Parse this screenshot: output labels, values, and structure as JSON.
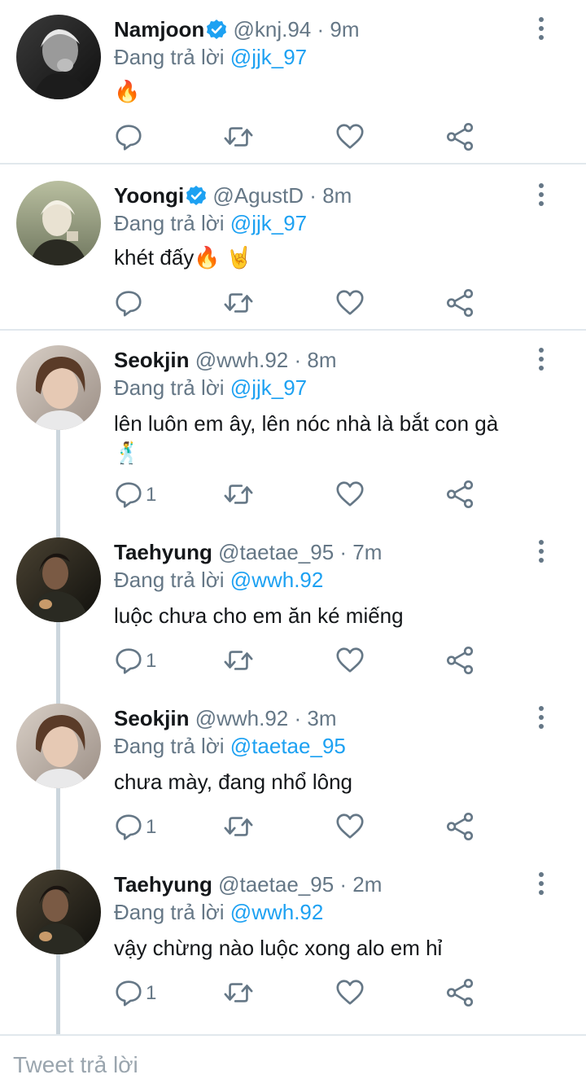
{
  "reply_prefix": "Đang trả lời",
  "tweets": [
    {
      "name": "Namjoon",
      "verified": true,
      "handle": "@knj.94",
      "separator": "·",
      "time": "9m",
      "reply_to": "@jjk_97",
      "text": "🔥",
      "reply_count": ""
    },
    {
      "name": "Yoongi",
      "verified": true,
      "handle": "@AgustD",
      "separator": "·",
      "time": "8m",
      "reply_to": "@jjk_97",
      "text": "khét đấy🔥 🤘",
      "reply_count": ""
    },
    {
      "name": "Seokjin",
      "verified": false,
      "handle": "@wwh.92",
      "separator": "·",
      "time": "8m",
      "reply_to": "@jjk_97",
      "text": "lên luôn em ây, lên nóc nhà là bắt con gà 🕺",
      "reply_count": "1"
    },
    {
      "name": "Taehyung",
      "verified": false,
      "handle": "@taetae_95",
      "separator": "·",
      "time": "7m",
      "reply_to": "@wwh.92",
      "text": "luộc chưa cho em ăn ké miếng",
      "reply_count": "1"
    },
    {
      "name": "Seokjin",
      "verified": false,
      "handle": "@wwh.92",
      "separator": "·",
      "time": "3m",
      "reply_to": "@taetae_95",
      "text": "chưa mày, đang nhổ lông",
      "reply_count": "1"
    },
    {
      "name": "Taehyung",
      "verified": false,
      "handle": "@taetae_95",
      "separator": "·",
      "time": "2m",
      "reply_to": "@wwh.92",
      "text": "vậy chừng nào luộc xong alo em hỉ",
      "reply_count": "1"
    }
  ],
  "reply_input": {
    "placeholder": "Tweet trả lời"
  },
  "colors": {
    "accent": "#1da1f2",
    "secondary_text": "#657786",
    "divider": "#e1e8ed",
    "thread_line": "#ccd6dd"
  },
  "icons": [
    "verified-badge-icon",
    "more-options-icon",
    "reply-icon",
    "retweet-icon",
    "like-icon",
    "share-icon"
  ]
}
